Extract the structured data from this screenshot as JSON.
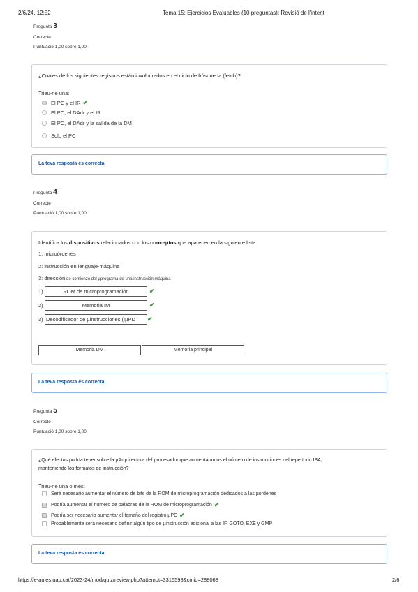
{
  "header": {
    "datetime": "2/6/24, 12:52",
    "title": "Tema 15: Ejercicios Evaluables (10 preguntas): Revisió de l'intent"
  },
  "footer": {
    "url": "https://e-aules.uab.cat/2023-24/mod/quiz/review.php?attempt=3316598&cmid=288068",
    "page": "2/6"
  },
  "q3": {
    "label": "Pregunta",
    "number": "3",
    "state": "Correcte",
    "grade": "Puntuació 1,00 sobre 1,00",
    "text": "¿Cuáles de los siguientes registros están involucrados en el ciclo de búsqueda (fetch)?",
    "prompt": "Trieu-ne una:",
    "options": [
      "El PC y el IR",
      "El PC, el DAdr y el IR",
      "El PC, el DAdr y la salida de la DM",
      "Solo el PC"
    ],
    "feedback": "La teva resposta és correcta."
  },
  "q4": {
    "label": "Pregunta",
    "number": "4",
    "state": "Correcte",
    "grade": "Puntuació 1,00 sobre 1,00",
    "text_pre": "Identifica los ",
    "text_b1": "dispositivos",
    "text_mid": " relacionados con los ",
    "text_b2": "conceptos",
    "text_post": " que aparecen en la siguiente lista:",
    "item1": "1: microórdenes",
    "item2": "2: instrucción en lenguaje-máquina",
    "item3_a": "3: dirección",
    "item3_b": " de comienzo del µprograma de una instrucción máquina",
    "answers": [
      {
        "num": "1)",
        "value": "ROM de microprogramación"
      },
      {
        "num": "2)",
        "value": "Memoria IM"
      },
      {
        "num": "3)",
        "value": "Decodificador de µinstrucciones (!µPD"
      }
    ],
    "choices": [
      "Memoria DM",
      "Memoria principal"
    ],
    "feedback": "La teva resposta és correcta."
  },
  "q5": {
    "label": "Pregunta",
    "number": "5",
    "state": "Correcte",
    "grade": "Puntuació 1,00 sobre 1,00",
    "text_line1": "¿Qué efectos podría tener sobre la µArquitectura del procesador que aumentáramos el número de instrucciones del repertorio ISA,",
    "text_line2": "manteniendo los formatos de instrucción?",
    "prompt": "Trieu-ne una o més:",
    "options": [
      "Será necesario aumentar el número de bits de la ROM de microprogramación dedicados a las µórdenes",
      "Podría aumentar el número de palabras de la ROM de microprogramación",
      "Podría ser necesario aumentar el tamaño del registro µPC",
      "Probablemente será necesario definir algún tipo de µinstrucción adicional a las IF, GOTO, EXE y GMP"
    ],
    "feedback": "La teva resposta és correcta."
  },
  "tick": "✔",
  "colors": {
    "tick": "#3c8c3c",
    "feedback_border": "#8ab4e8",
    "feedback_text": "#1a5aa6"
  }
}
